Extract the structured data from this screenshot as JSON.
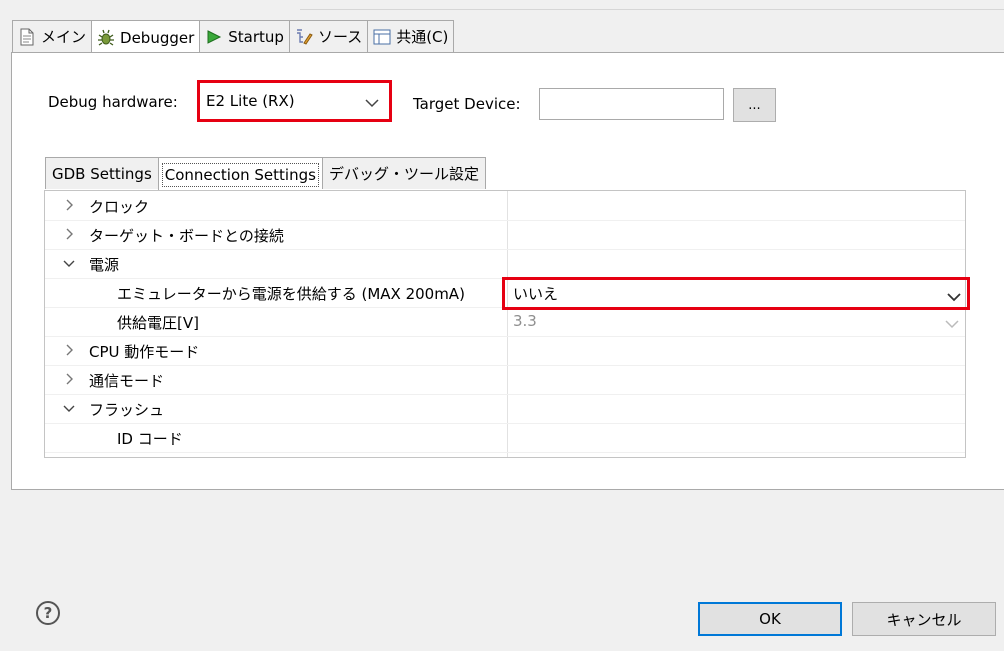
{
  "top_tabs": [
    {
      "label": "メイン",
      "icon": "document-icon"
    },
    {
      "label": "Debugger",
      "icon": "bug-icon",
      "active": true
    },
    {
      "label": "Startup",
      "icon": "play-icon"
    },
    {
      "label": "ソース",
      "icon": "source-icon"
    },
    {
      "label": "共通(C)",
      "icon": "table-icon"
    }
  ],
  "debug_hardware": {
    "label": "Debug hardware:",
    "value": "E2 Lite (RX)"
  },
  "target_device": {
    "label": "Target Device:",
    "value": "",
    "browse_label": "..."
  },
  "inner_tabs": [
    {
      "label": "GDB Settings"
    },
    {
      "label": "Connection Settings",
      "active": true
    },
    {
      "label": "デバッグ・ツール設定"
    }
  ],
  "tree_rows": [
    {
      "name": "クロック",
      "value": "",
      "expander": "collapsed",
      "level": 0
    },
    {
      "name": "ターゲット・ボードとの接続",
      "value": "",
      "expander": "collapsed",
      "level": 0
    },
    {
      "name": "電源",
      "value": "",
      "expander": "expanded",
      "level": 0
    },
    {
      "name": "エミュレーターから電源を供給する (MAX 200mA)",
      "value": "いいえ",
      "level": 1
    },
    {
      "name": "供給電圧[V]",
      "value": "3.3",
      "level": 1,
      "disabled": true
    },
    {
      "name": "CPU 動作モード",
      "value": "",
      "expander": "collapsed",
      "level": 0
    },
    {
      "name": "通信モード",
      "value": "",
      "expander": "collapsed",
      "level": 0
    },
    {
      "name": "フラッシュ",
      "value": "",
      "expander": "expanded",
      "level": 0
    },
    {
      "name": "ID コード",
      "value": "",
      "level": 1
    }
  ],
  "buttons": {
    "ok": "OK",
    "cancel": "キャンセル"
  },
  "help_glyph": "?",
  "colors": {
    "highlight": "#e60012",
    "focus": "#0078d7"
  }
}
